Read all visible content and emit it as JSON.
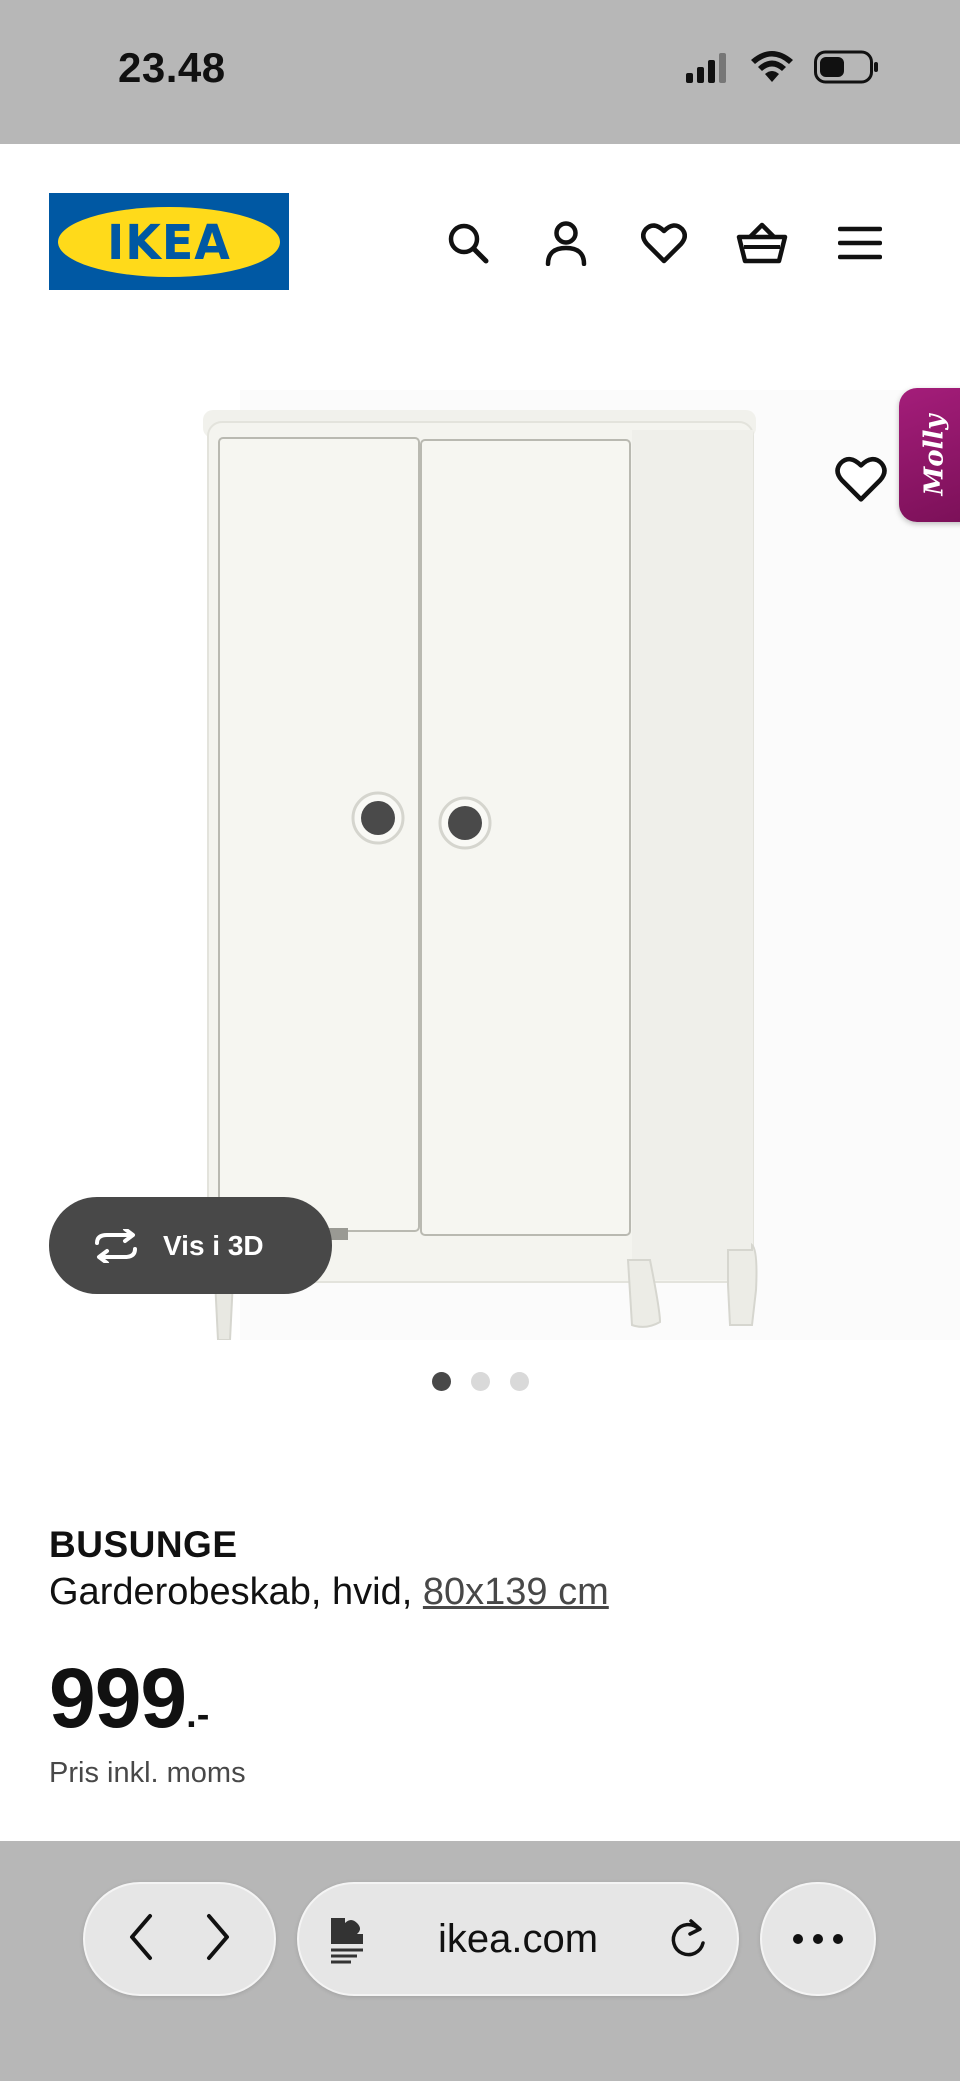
{
  "status_bar": {
    "time": "23.48",
    "signal_icon": "cellular-signal-icon",
    "wifi_icon": "wifi-icon",
    "battery_icon": "battery-icon"
  },
  "header": {
    "logo_text": "IKEA",
    "icons": [
      "search-icon",
      "account-icon",
      "favorites-heart-icon",
      "basket-icon",
      "menu-icon"
    ]
  },
  "gallery": {
    "molly_label": "Molly",
    "vis3d_label": "Vis i 3D",
    "dots": 3,
    "active_dot": 1
  },
  "product": {
    "name": "BUSUNGE",
    "description": "Garderobeskab, hvid,",
    "size": "80x139 cm",
    "price": "999",
    "price_suffix": ".-",
    "price_note": "Pris inkl. moms"
  },
  "browser": {
    "url": "ikea.com",
    "icons": [
      "back-icon",
      "forward-icon",
      "page-settings-icon",
      "reload-icon",
      "more-icon"
    ]
  },
  "colors": {
    "ikea_blue": "#0058a3",
    "ikea_yellow": "#ffda1a",
    "molly_magenta": "#a41d7a",
    "button_dark": "#484848",
    "browser_gray": "#b7b7b7"
  }
}
